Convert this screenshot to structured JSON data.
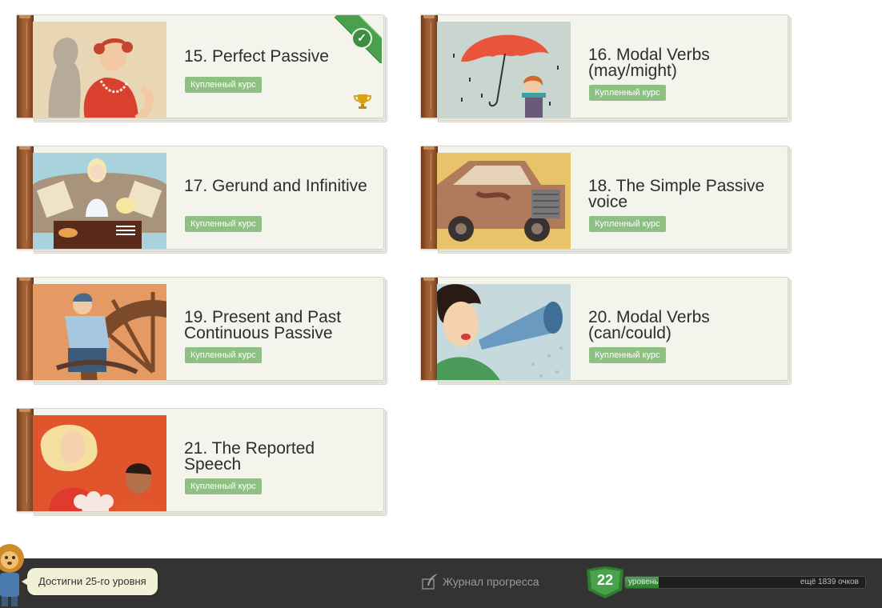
{
  "courses": [
    {
      "title": "15. Perfect Passive",
      "badge": "Купленный курс",
      "completed": true,
      "trophy": true,
      "picture": "woman-with-pearls-and-shadow"
    },
    {
      "title": "16. Modal Verbs (may/might)",
      "badge": "Купленный курс",
      "completed": false,
      "trophy": false,
      "picture": "girl-with-red-umbrella-in-rain"
    },
    {
      "title": "17. Gerund and Infinitive",
      "badge": "Купленный курс",
      "completed": false,
      "trophy": false,
      "picture": "girl-on-sofa-with-popcorn"
    },
    {
      "title": "18. The Simple Passive voice",
      "badge": "Купленный курс",
      "completed": false,
      "trophy": false,
      "picture": "rusty-old-car"
    },
    {
      "title": "19. Present and Past Continuous Passive",
      "badge": "Купленный курс",
      "completed": false,
      "trophy": false,
      "picture": "worker-repairing-wheel"
    },
    {
      "title": "20. Modal Verbs (can/could)",
      "badge": "Купленный курс",
      "completed": false,
      "trophy": false,
      "picture": "woman-with-megaphone"
    },
    {
      "title": "21. The Reported Speech",
      "badge": "Купленный курс",
      "completed": false,
      "trophy": false,
      "picture": "singer-and-man"
    }
  ],
  "status_bar": {
    "mascot": "lion-mascot",
    "goal_text": "Достигни 25-го уровня",
    "journal_label": "Журнал прогресса",
    "journal_icon": "feather-pen-icon",
    "level": "22",
    "level_label": "уровень",
    "remaining_text": "ещё 1839 очков",
    "progress_fraction": 0.14
  },
  "colors": {
    "badge_green": "#8fc083",
    "ribbon_green": "#4aa14c",
    "status_bar_bg": "#333333",
    "spine_brown": "#9a5a30"
  }
}
